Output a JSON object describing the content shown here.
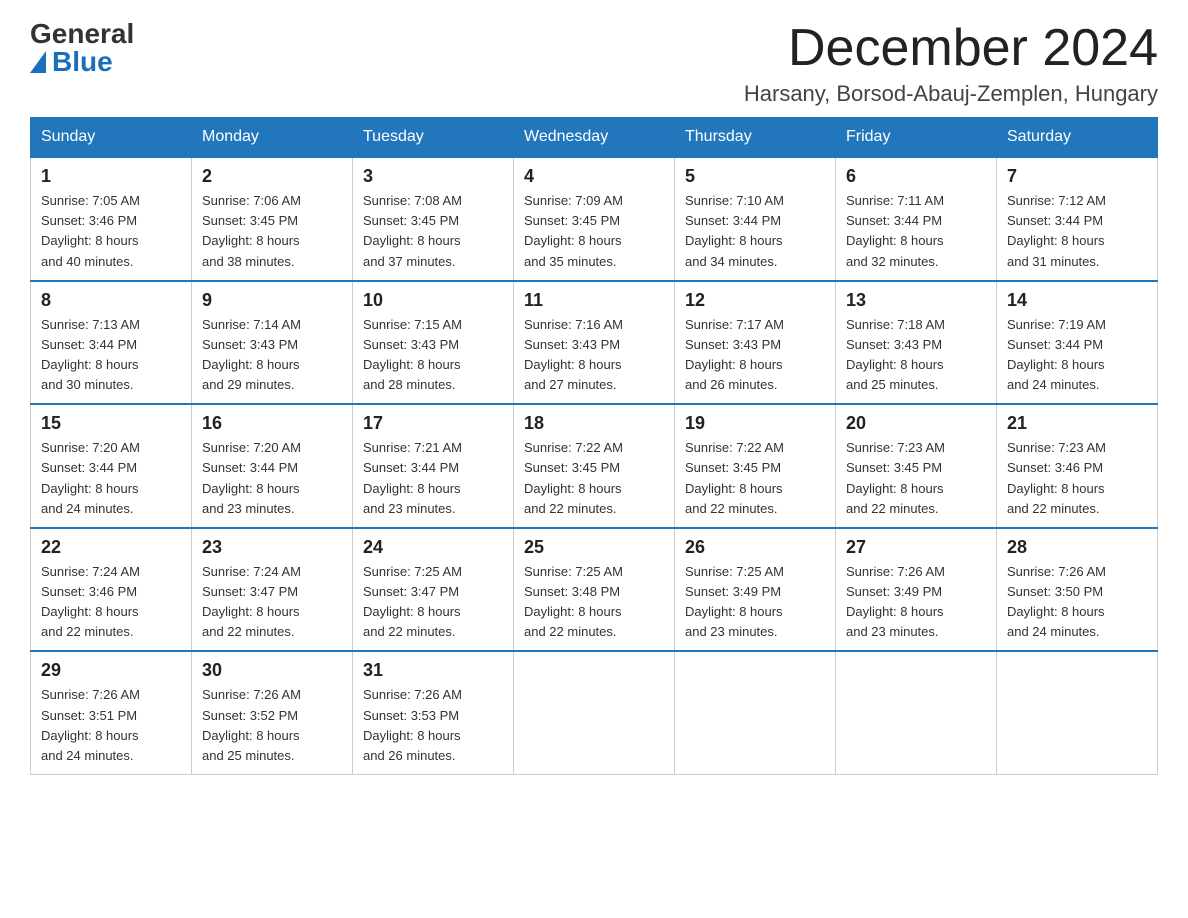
{
  "logo": {
    "general": "General",
    "blue": "Blue"
  },
  "header": {
    "month_title": "December 2024",
    "location": "Harsany, Borsod-Abauj-Zemplen, Hungary"
  },
  "days_of_week": [
    "Sunday",
    "Monday",
    "Tuesday",
    "Wednesday",
    "Thursday",
    "Friday",
    "Saturday"
  ],
  "weeks": [
    [
      {
        "day": "1",
        "sunrise": "7:05 AM",
        "sunset": "3:46 PM",
        "daylight": "8 hours and 40 minutes."
      },
      {
        "day": "2",
        "sunrise": "7:06 AM",
        "sunset": "3:45 PM",
        "daylight": "8 hours and 38 minutes."
      },
      {
        "day": "3",
        "sunrise": "7:08 AM",
        "sunset": "3:45 PM",
        "daylight": "8 hours and 37 minutes."
      },
      {
        "day": "4",
        "sunrise": "7:09 AM",
        "sunset": "3:45 PM",
        "daylight": "8 hours and 35 minutes."
      },
      {
        "day": "5",
        "sunrise": "7:10 AM",
        "sunset": "3:44 PM",
        "daylight": "8 hours and 34 minutes."
      },
      {
        "day": "6",
        "sunrise": "7:11 AM",
        "sunset": "3:44 PM",
        "daylight": "8 hours and 32 minutes."
      },
      {
        "day": "7",
        "sunrise": "7:12 AM",
        "sunset": "3:44 PM",
        "daylight": "8 hours and 31 minutes."
      }
    ],
    [
      {
        "day": "8",
        "sunrise": "7:13 AM",
        "sunset": "3:44 PM",
        "daylight": "8 hours and 30 minutes."
      },
      {
        "day": "9",
        "sunrise": "7:14 AM",
        "sunset": "3:43 PM",
        "daylight": "8 hours and 29 minutes."
      },
      {
        "day": "10",
        "sunrise": "7:15 AM",
        "sunset": "3:43 PM",
        "daylight": "8 hours and 28 minutes."
      },
      {
        "day": "11",
        "sunrise": "7:16 AM",
        "sunset": "3:43 PM",
        "daylight": "8 hours and 27 minutes."
      },
      {
        "day": "12",
        "sunrise": "7:17 AM",
        "sunset": "3:43 PM",
        "daylight": "8 hours and 26 minutes."
      },
      {
        "day": "13",
        "sunrise": "7:18 AM",
        "sunset": "3:43 PM",
        "daylight": "8 hours and 25 minutes."
      },
      {
        "day": "14",
        "sunrise": "7:19 AM",
        "sunset": "3:44 PM",
        "daylight": "8 hours and 24 minutes."
      }
    ],
    [
      {
        "day": "15",
        "sunrise": "7:20 AM",
        "sunset": "3:44 PM",
        "daylight": "8 hours and 24 minutes."
      },
      {
        "day": "16",
        "sunrise": "7:20 AM",
        "sunset": "3:44 PM",
        "daylight": "8 hours and 23 minutes."
      },
      {
        "day": "17",
        "sunrise": "7:21 AM",
        "sunset": "3:44 PM",
        "daylight": "8 hours and 23 minutes."
      },
      {
        "day": "18",
        "sunrise": "7:22 AM",
        "sunset": "3:45 PM",
        "daylight": "8 hours and 22 minutes."
      },
      {
        "day": "19",
        "sunrise": "7:22 AM",
        "sunset": "3:45 PM",
        "daylight": "8 hours and 22 minutes."
      },
      {
        "day": "20",
        "sunrise": "7:23 AM",
        "sunset": "3:45 PM",
        "daylight": "8 hours and 22 minutes."
      },
      {
        "day": "21",
        "sunrise": "7:23 AM",
        "sunset": "3:46 PM",
        "daylight": "8 hours and 22 minutes."
      }
    ],
    [
      {
        "day": "22",
        "sunrise": "7:24 AM",
        "sunset": "3:46 PM",
        "daylight": "8 hours and 22 minutes."
      },
      {
        "day": "23",
        "sunrise": "7:24 AM",
        "sunset": "3:47 PM",
        "daylight": "8 hours and 22 minutes."
      },
      {
        "day": "24",
        "sunrise": "7:25 AM",
        "sunset": "3:47 PM",
        "daylight": "8 hours and 22 minutes."
      },
      {
        "day": "25",
        "sunrise": "7:25 AM",
        "sunset": "3:48 PM",
        "daylight": "8 hours and 22 minutes."
      },
      {
        "day": "26",
        "sunrise": "7:25 AM",
        "sunset": "3:49 PM",
        "daylight": "8 hours and 23 minutes."
      },
      {
        "day": "27",
        "sunrise": "7:26 AM",
        "sunset": "3:49 PM",
        "daylight": "8 hours and 23 minutes."
      },
      {
        "day": "28",
        "sunrise": "7:26 AM",
        "sunset": "3:50 PM",
        "daylight": "8 hours and 24 minutes."
      }
    ],
    [
      {
        "day": "29",
        "sunrise": "7:26 AM",
        "sunset": "3:51 PM",
        "daylight": "8 hours and 24 minutes."
      },
      {
        "day": "30",
        "sunrise": "7:26 AM",
        "sunset": "3:52 PM",
        "daylight": "8 hours and 25 minutes."
      },
      {
        "day": "31",
        "sunrise": "7:26 AM",
        "sunset": "3:53 PM",
        "daylight": "8 hours and 26 minutes."
      },
      null,
      null,
      null,
      null
    ]
  ],
  "labels": {
    "sunrise_prefix": "Sunrise: ",
    "sunset_prefix": "Sunset: ",
    "daylight_prefix": "Daylight: "
  }
}
